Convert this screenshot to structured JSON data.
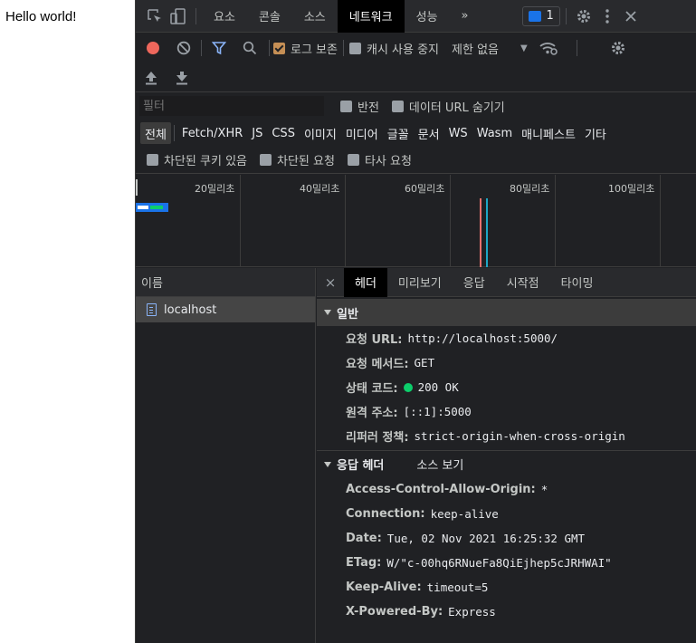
{
  "page": {
    "text": "Hello world!"
  },
  "topbar": {
    "tabs": [
      "요소",
      "콘솔",
      "소스",
      "네트워크",
      "성능"
    ],
    "active_tab": "네트워크",
    "more": "»",
    "message_count": "1"
  },
  "toolbar": {
    "preserve_log": "로그 보존",
    "disable_cache": "캐시 사용 중지",
    "throttle": "제한 없음"
  },
  "filter": {
    "placeholder": "필터",
    "invert": "반전",
    "hide_data_urls": "데이터 URL 숨기기",
    "types": [
      "전체",
      "Fetch/XHR",
      "JS",
      "CSS",
      "이미지",
      "미디어",
      "글꼴",
      "문서",
      "WS",
      "Wasm",
      "매니페스트",
      "기타"
    ],
    "blocked_cookies": "차단된 쿠키 있음",
    "blocked_requests": "차단된 요청",
    "third_party": "타사 요청"
  },
  "timeline": {
    "ticks": [
      "20밀리초",
      "40밀리초",
      "60밀리초",
      "80밀리초",
      "100밀리초"
    ]
  },
  "requests": {
    "header": "이름",
    "items": [
      "localhost"
    ]
  },
  "detail": {
    "tabs": [
      "헤더",
      "미리보기",
      "응답",
      "시작점",
      "타이밍"
    ],
    "active_tab": "헤더",
    "general": {
      "title": "일반",
      "rows": [
        {
          "key": "요청 URL:",
          "value": "http://localhost:5000/"
        },
        {
          "key": "요청 메서드:",
          "value": "GET"
        },
        {
          "key": "상태 코드:",
          "value": "200 OK"
        },
        {
          "key": "원격 주소:",
          "value": "[::1]:5000"
        },
        {
          "key": "리퍼러 정책:",
          "value": "strict-origin-when-cross-origin"
        }
      ]
    },
    "response_headers": {
      "title": "응답 헤더",
      "view_source": "소스 보기",
      "rows": [
        {
          "key": "Access-Control-Allow-Origin:",
          "value": "*"
        },
        {
          "key": "Connection:",
          "value": "keep-alive"
        },
        {
          "key": "Date:",
          "value": "Tue, 02 Nov 2021 16:25:32 GMT"
        },
        {
          "key": "ETag:",
          "value": "W/\"c-00hq6RNueFa8QiEjhep5cJRHWAI\""
        },
        {
          "key": "Keep-Alive:",
          "value": "timeout=5"
        },
        {
          "key": "X-Powered-By:",
          "value": "Express"
        }
      ]
    }
  }
}
